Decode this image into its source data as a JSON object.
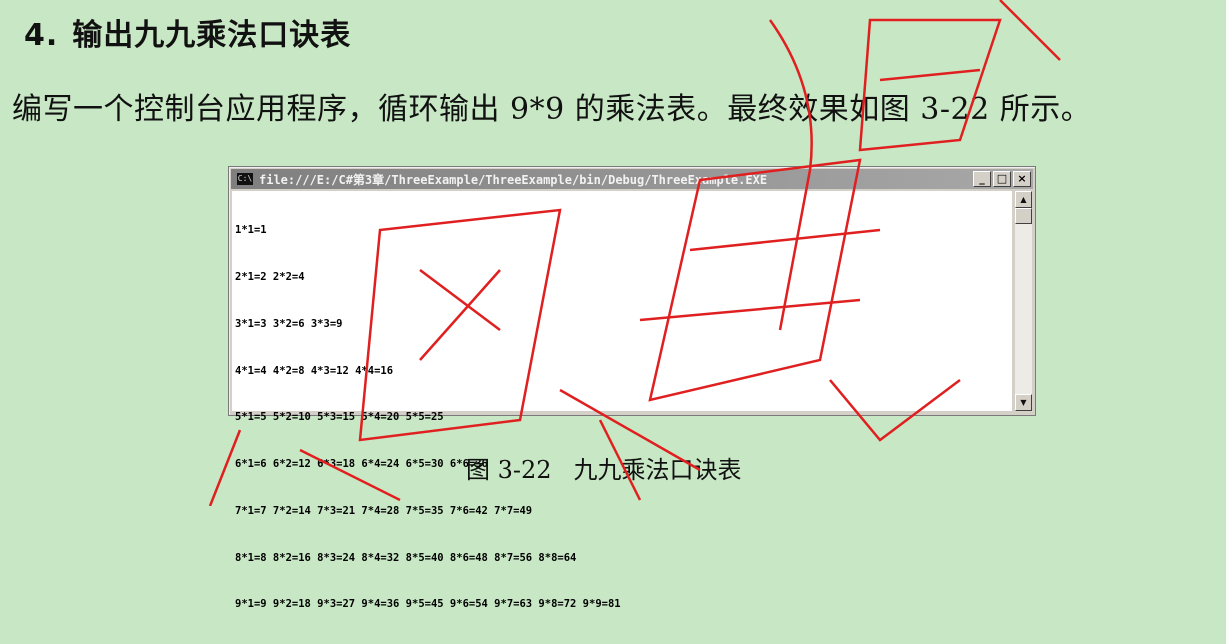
{
  "heading": {
    "number": "4.",
    "text": "输出九九乘法口诀表"
  },
  "paragraph": "编写一个控制台应用程序，循环输出 9*9 的乘法表。最终效果如图 3-22 所示。",
  "console": {
    "icon": "C:\\",
    "title": "file:///E:/C#第3章/ThreeExample/ThreeExample/bin/Debug/ThreeExample.EXE",
    "buttons": [
      "_",
      "□",
      "×"
    ],
    "lines": [
      "1*1=1",
      "2*1=2 2*2=4",
      "3*1=3 3*2=6 3*3=9",
      "4*1=4 4*2=8 4*3=12 4*4=16",
      "5*1=5 5*2=10 5*3=15 5*4=20 5*5=25",
      "6*1=6 6*2=12 6*3=18 6*4=24 6*5=30 6*6=36",
      "7*1=7 7*2=14 7*3=21 7*4=28 7*5=35 7*6=42 7*7=49",
      "8*1=8 8*2=16 8*3=24 8*4=32 8*5=40 8*6=48 8*7=56 8*8=64",
      "9*1=9 9*2=18 9*3=27 9*4=36 9*5=45 9*6=54 9*7=63 9*8=72 9*9=81"
    ]
  },
  "caption": {
    "label": "图 3-22",
    "text": "九九乘法口诀表"
  },
  "watermark": {
    "text": "图书",
    "color": "#e02020"
  }
}
